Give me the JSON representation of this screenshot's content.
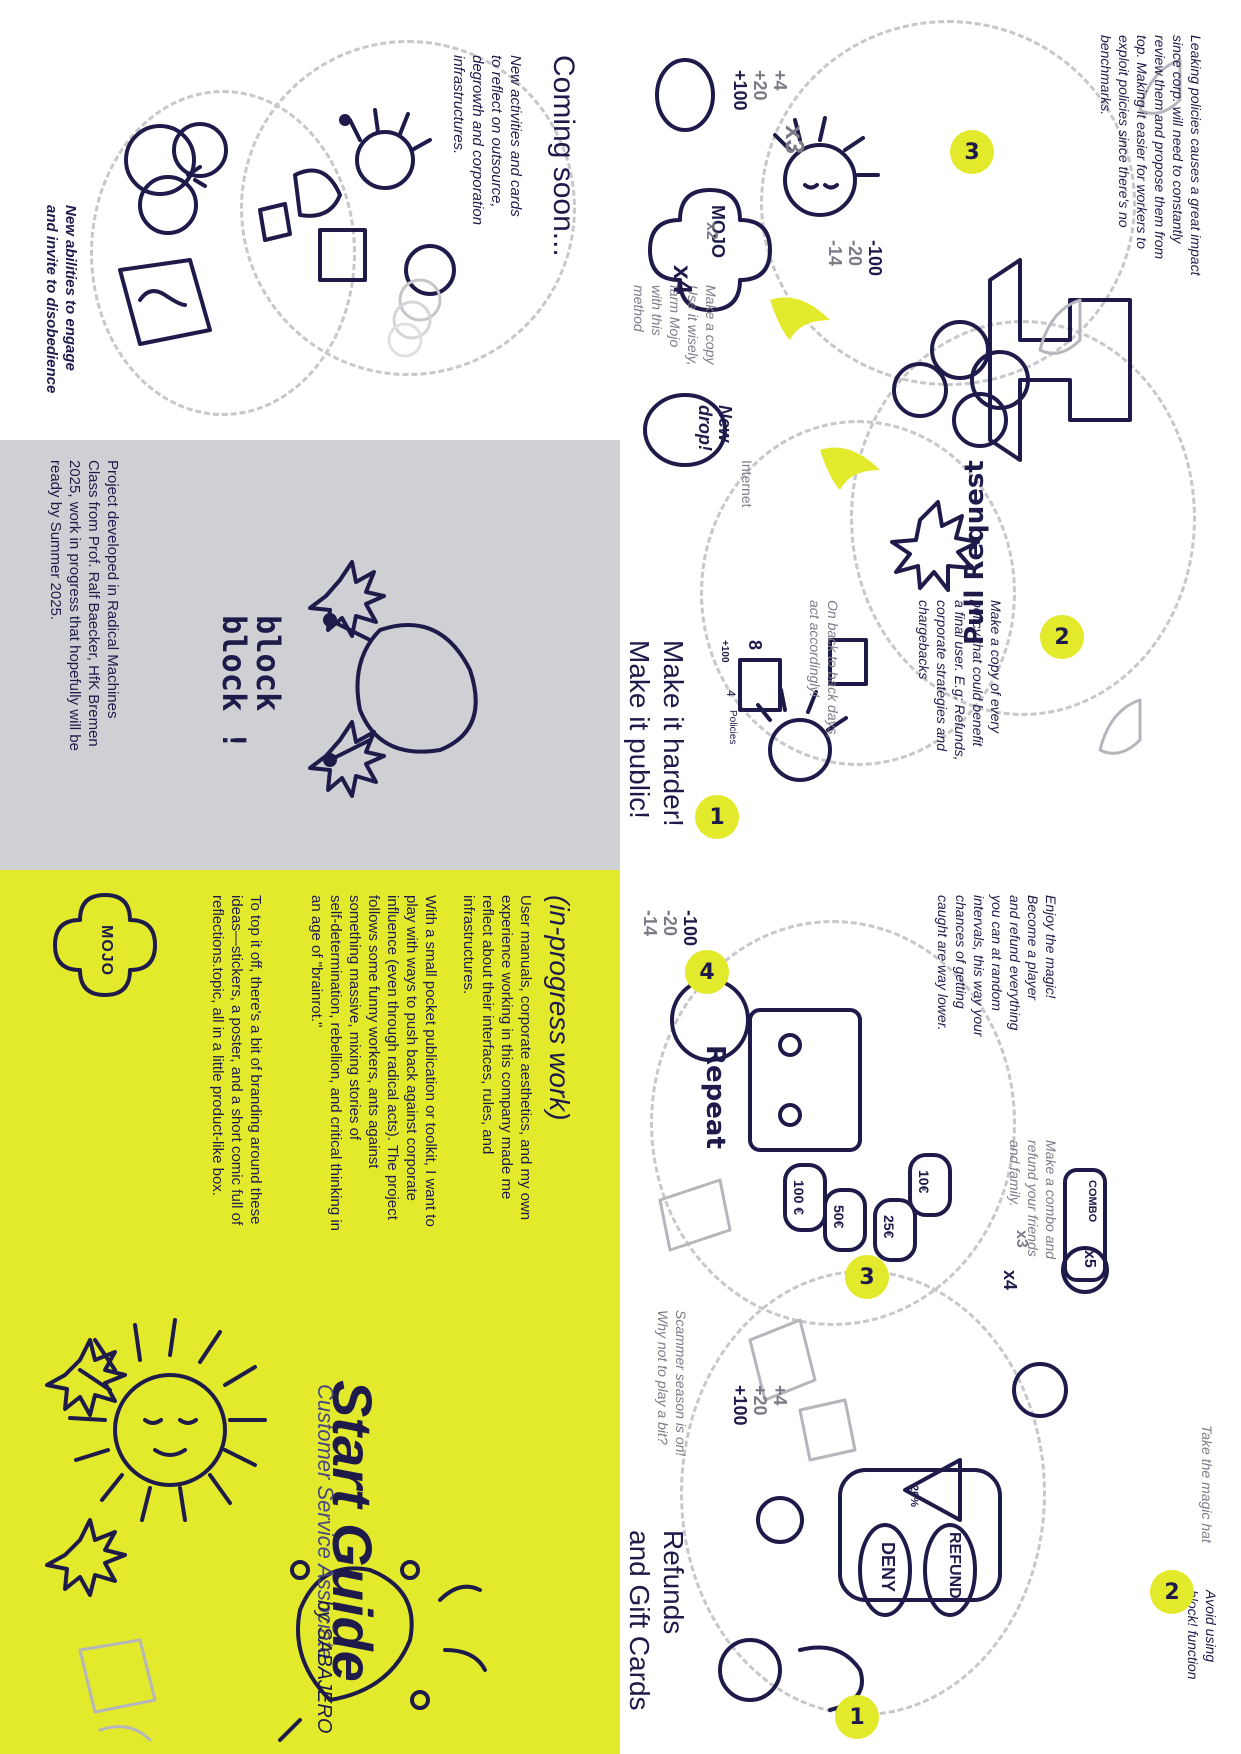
{
  "coming_soon": {
    "title": "Coming soon...",
    "text1": "New activities and cards\nto reflect on outsource,\ndegrowth and corporation\ninfrastructures.",
    "text2": "New abilities to engage\nand invite to disobedience"
  },
  "project": {
    "brand": "block\nblock !",
    "note": "Project developed in Radical Machines\nClass from Prof. Ralf Baecker, HfK Bremen\n2025, work in progress that hopefully will be\nready by Summer 2025."
  },
  "intro": {
    "heading": "(in-progress work)",
    "para1": "User manuals, corporate aesthetics, and my own\nexperience working in this company made me\nreflect about their interfaces, rules, and\ninfrastructures.",
    "para2": "With a small pocket publication or toolkit, I want to\nplay with ways to push back against corporate\ninfluence (even through radical acts). The project\nfollows some funny workers, ants against\nsomething massive, mixing stories of\nself-determination, rebellion, and critical thinking in\nan age of \"brainrot.\"",
    "para3": "To top it off, there's a bit of branding around these\nideas—stickers, a poster, and a short comic full of\nreflections.topic, all in a little product-like box.",
    "mojo": "MOJO"
  },
  "cover": {
    "title": "Start Guide",
    "subtitle": "Customer Service Associate",
    "author": "by SABAJERO"
  },
  "harder": {
    "title": "Make it harder!\nMake it public!",
    "step1_note": "On back to back days,\nact accordingly!",
    "policy_count": "8",
    "policy_small": "4",
    "policy_label": "Policies",
    "plus100": "+100",
    "internet": "Internet",
    "new_drop": "New\ndrop!",
    "make_copy": "Make a copy\nUse it wisely,\nfarm Mojo\nwith this\nmethod",
    "mojo": "MOJO",
    "x3": "x3",
    "x4": "x4",
    "x2": "x2",
    "scores_top": [
      "+4",
      "+20",
      "+100"
    ],
    "scores_mid": [
      "-100",
      "-20",
      "-14"
    ],
    "pull_request": "Pull Request",
    "step2_note": "Make a copy of every\npolicy that could benefit\na final user. E.g: Refunds,\ncorporate strategies and\nchargebacks",
    "leak_note": "Leaking policies causes a great impact\nsince corp. will need to constantly\nreview them and propose them from\ntop. Making it easier for workers to\nexploit policies since there's no\nbenchmarks.",
    "steps": [
      "1",
      "2",
      "3"
    ]
  },
  "refunds": {
    "title": "Refunds\nand Gift Cards",
    "scammer": "Scammer season is on!\nWhy not to play a bit?",
    "scores": [
      "+4",
      "+20",
      "+100"
    ],
    "deny": "DENY",
    "refund": "REFUND",
    "pct": "20%",
    "block_fn": "Avoid using\nblock! function",
    "magic_hat": "Take the magic hat",
    "repeat": "Repeat",
    "bills": [
      "50€",
      "100 €",
      "25€",
      "10€"
    ],
    "enjoy": "Enjoy the magic!\nBecome a player\nand refund everything\nyou can at random\nintervals, this way your\nchances of getting\ncaught are way lower.",
    "combo": "Make a combo and\nrefund your friends\nand family.",
    "x5": "x5",
    "combo_word": "COMBO",
    "x3": "x3",
    "x4": "x4",
    "scores_neg": [
      "-100",
      "-20",
      "-14"
    ],
    "steps": [
      "1",
      "2",
      "3",
      "4"
    ]
  },
  "colors": {
    "accent": "#e3ea2c",
    "ink": "#1e1b4b",
    "grey": "#cfd0d3",
    "muted": "#7b7b86"
  }
}
